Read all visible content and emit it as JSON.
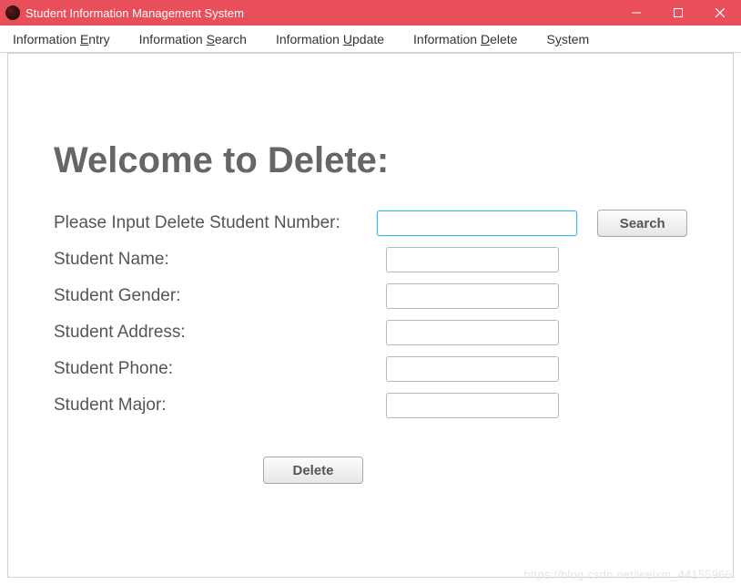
{
  "window": {
    "title": "Student Information Management System"
  },
  "menubar": {
    "items": [
      {
        "pre": "Information ",
        "ul": "E",
        "post": "ntry"
      },
      {
        "pre": "Information ",
        "ul": "S",
        "post": "earch"
      },
      {
        "pre": "Information ",
        "ul": "U",
        "post": "pdate"
      },
      {
        "pre": "Information ",
        "ul": "D",
        "post": "elete"
      },
      {
        "pre": "S",
        "ul": "y",
        "post": "stem"
      }
    ]
  },
  "main": {
    "heading": "Welcome to Delete:",
    "primary_label": "Please Input Delete Student Number:",
    "search_button": "Search",
    "fields": [
      {
        "label": "Student Name:",
        "value": ""
      },
      {
        "label": "Student Gender:",
        "value": ""
      },
      {
        "label": "Student Address:",
        "value": ""
      },
      {
        "label": "Student Phone:",
        "value": ""
      },
      {
        "label": "Student Major:",
        "value": ""
      }
    ],
    "delete_button": "Delete",
    "student_number_value": ""
  },
  "watermark": "https://blog.csdn.net/weixin_44155966"
}
